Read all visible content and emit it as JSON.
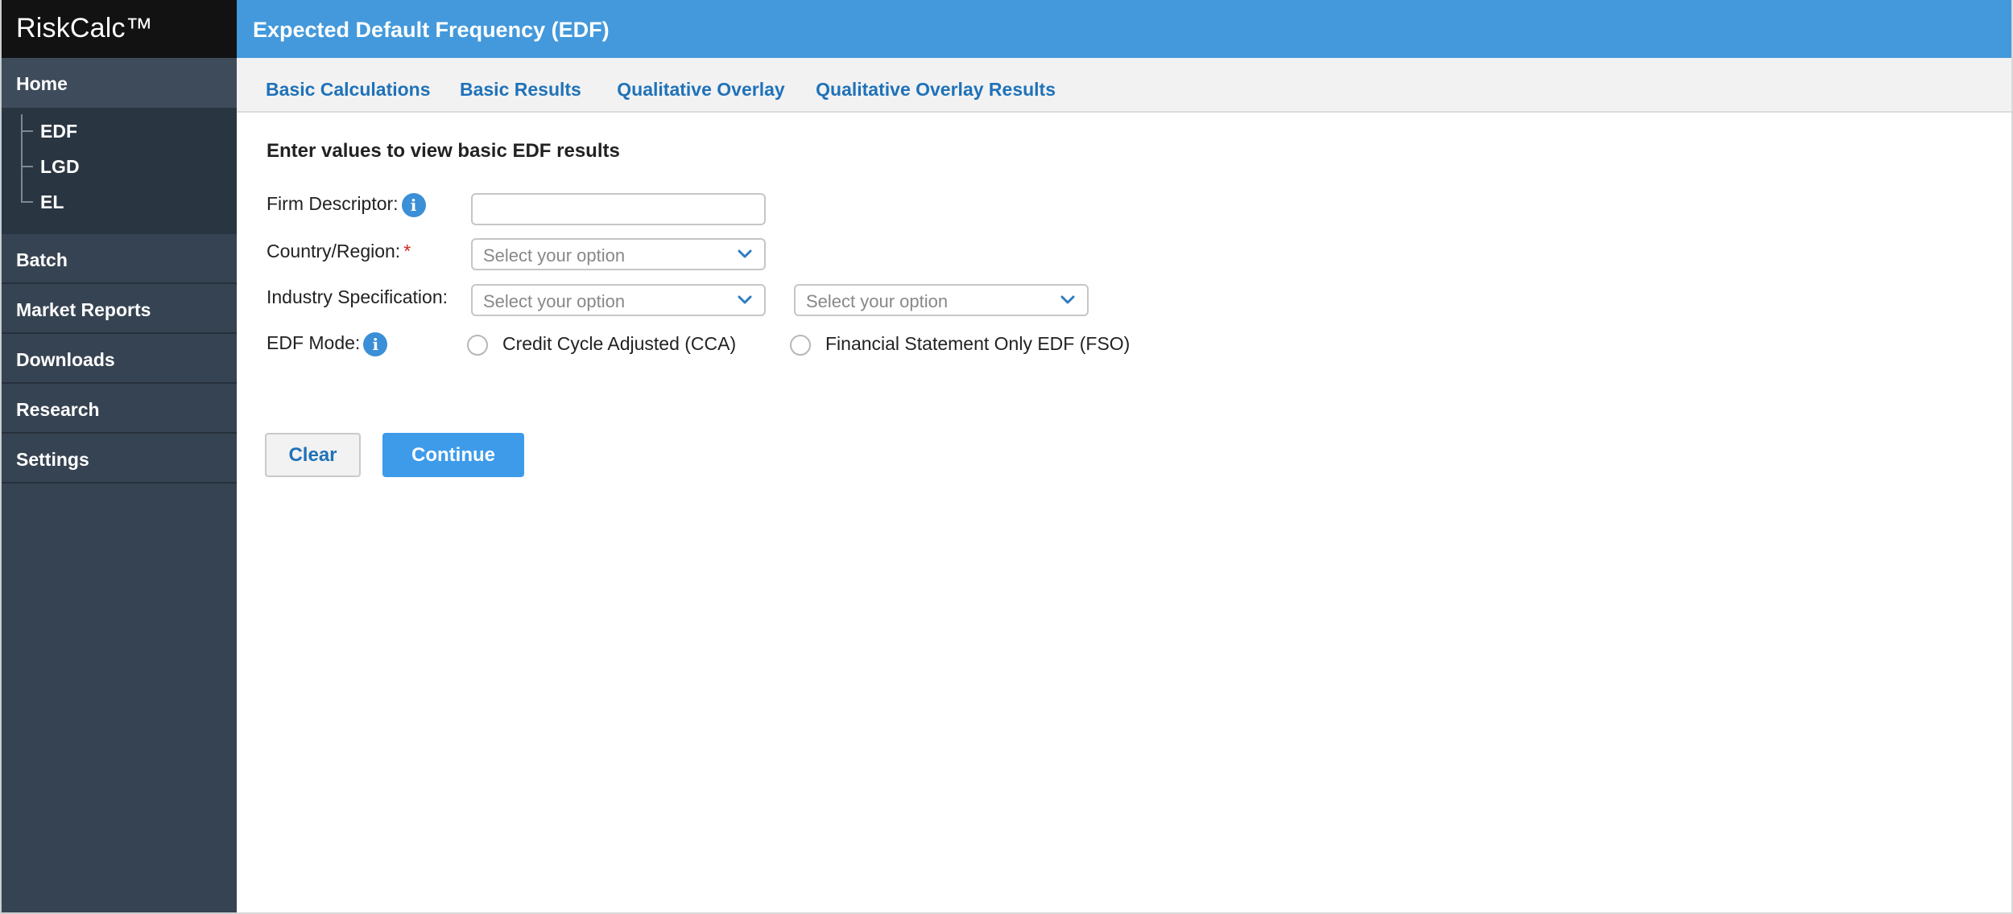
{
  "app": {
    "brand": "RiskCalc™"
  },
  "sidebar": {
    "home": "Home",
    "subitems": [
      "EDF",
      "LGD",
      "EL"
    ],
    "items": [
      "Batch",
      "Market Reports",
      "Downloads",
      "Research",
      "Settings"
    ]
  },
  "header": {
    "title": "Expected Default Frequency (EDF)"
  },
  "tabs": [
    "Basic Calculations",
    "Basic Results",
    "Qualitative Overlay",
    "Qualitative Overlay Results"
  ],
  "form": {
    "title": "Enter values to view basic EDF results",
    "firm_descriptor_label": "Firm Descriptor:",
    "firm_descriptor_value": "",
    "country_label": "Country/Region:",
    "required_mark": "*",
    "country_placeholder": "Select your option",
    "industry_label": "Industry Specification:",
    "industry_placeholder_1": "Select your option",
    "industry_placeholder_2": "Select your option",
    "edf_mode_label": "EDF Mode:",
    "edf_mode_options": [
      "Credit Cycle Adjusted (CCA)",
      "Financial Statement Only EDF (FSO)"
    ],
    "info_glyph": "i"
  },
  "buttons": {
    "clear": "Clear",
    "continue": "Continue"
  },
  "colors": {
    "header_blue": "#4399db",
    "sidebar_bg": "#364352",
    "link_blue": "#1f72b8",
    "primary_button": "#3d9bea",
    "required_red": "#d0261f"
  }
}
